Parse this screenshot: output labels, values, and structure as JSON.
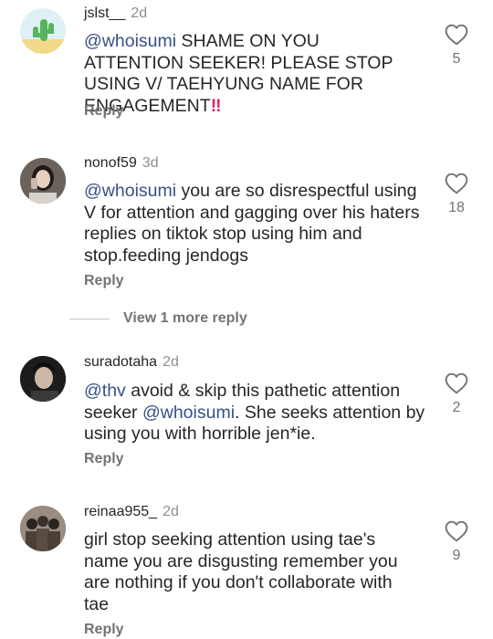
{
  "comments": [
    {
      "username": "jslst__",
      "time": "2d",
      "mention": "@whoisumi",
      "text": " SHAME ON YOU ATTENTION SEEKER! PLEASE STOP USING V/ TAEHYUNG NAME FOR ENGAGEMENT",
      "emoji": "‼",
      "likes": "5",
      "reply_label": "Reply"
    },
    {
      "username": "nonof59",
      "time": "3d",
      "mention": "@whoisumi",
      "text": " you are so disrespectful using V for attention and gagging over his haters replies on tiktok stop using him and stop.feeding jendogs",
      "likes": "18",
      "reply_label": "Reply"
    },
    {
      "username": "suradotaha",
      "time": "2d",
      "mention": "@thv",
      "text_a": " avoid & skip this pathetic attention seeker ",
      "mention2": "@whoisumi",
      "text_b": ". She seeks attention by  using you with horrible jen*ie.",
      "likes": "2",
      "reply_label": "Reply"
    },
    {
      "username": "reinaa955_",
      "time": "2d",
      "text": "girl stop seeking attention using tae's name you are disgusting remember you are nothing if you don't collaborate with tae",
      "likes": "9",
      "reply_label": "Reply"
    }
  ],
  "view_more": "View 1 more reply",
  "colors": {
    "mention": "#385185",
    "muted": "#737373",
    "heart_stroke": "#737373",
    "emoji": "#e0245e"
  }
}
